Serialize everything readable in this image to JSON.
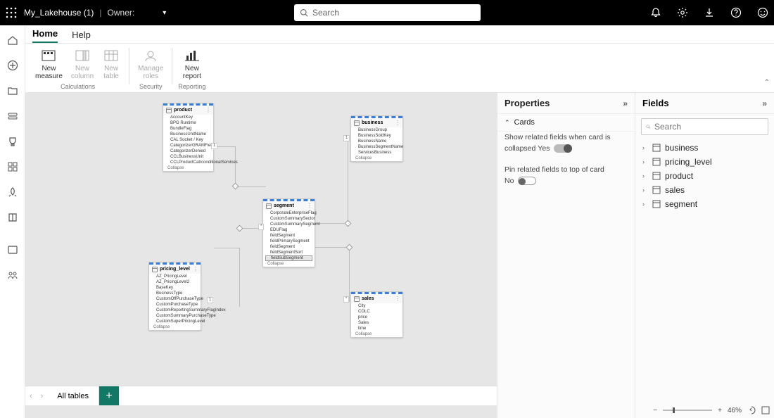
{
  "topbar": {
    "title": "My_Lakehouse (1)",
    "owner_label": "Owner:",
    "search_placeholder": "Search"
  },
  "tabs": {
    "home": "Home",
    "help": "Help"
  },
  "ribbon": {
    "new_measure": "New\nmeasure",
    "new_column": "New\ncolumn",
    "new_table": "New\ntable",
    "calc_group": "Calculations",
    "manage_roles": "Manage\nroles",
    "security_group": "Security",
    "new_report": "New\nreport",
    "reporting_group": "Reporting"
  },
  "canvas": {
    "collapse_label": "Collapse",
    "tables": {
      "product": {
        "name": "product",
        "fields": [
          "AccountKey",
          "BPG Runtime",
          "BundleFlag",
          "BusinessUnitName",
          "CAL Socket / Key",
          "CategorizerGRAMField",
          "CategorizerDenied",
          "CCLBusinessUnit",
          "CCLProductCatrconditionalServices"
        ]
      },
      "business": {
        "name": "business",
        "fields": [
          "BusinessGroup",
          "BusinessSoldKey",
          "BusinessName",
          "BusinessSegmentName",
          "ServicesBusiness"
        ]
      },
      "segment": {
        "name": "segment",
        "fields": [
          "CorporateEnterpriseFlag",
          "CustomSummarySector",
          "CustomSummarySegment",
          "EDUFlag",
          "fieldSegment",
          "fieldPrimarySegment",
          "fieldSegment",
          "fieldSegmentSort",
          "fieldSubSegment"
        ]
      },
      "pricing_level": {
        "name": "pricing_level",
        "fields": [
          "AZ_PricingLevel",
          "AZ_PricingLevel2",
          "BaseKey",
          "BusinessType",
          "CustomOffPurchaseType",
          "CustomPurchaseType",
          "CustomReportingSummaryFlagIndex",
          "CustomSummaryPurchaseType",
          "CustomSuperPricingLevel"
        ]
      },
      "sales": {
        "name": "sales",
        "fields": [
          "City",
          "COLC",
          "price",
          "Sales",
          "time"
        ]
      }
    }
  },
  "properties": {
    "title": "Properties",
    "cards_section": "Cards",
    "show_related": "Show related fields when card is collapsed",
    "yes": "Yes",
    "pin_related": "Pin related fields to top of card",
    "no": "No"
  },
  "fields": {
    "title": "Fields",
    "search_placeholder": "Search",
    "items": [
      "business",
      "pricing_level",
      "product",
      "sales",
      "segment"
    ]
  },
  "bottom": {
    "all_tables": "All tables"
  },
  "status": {
    "zoom": "46%"
  }
}
